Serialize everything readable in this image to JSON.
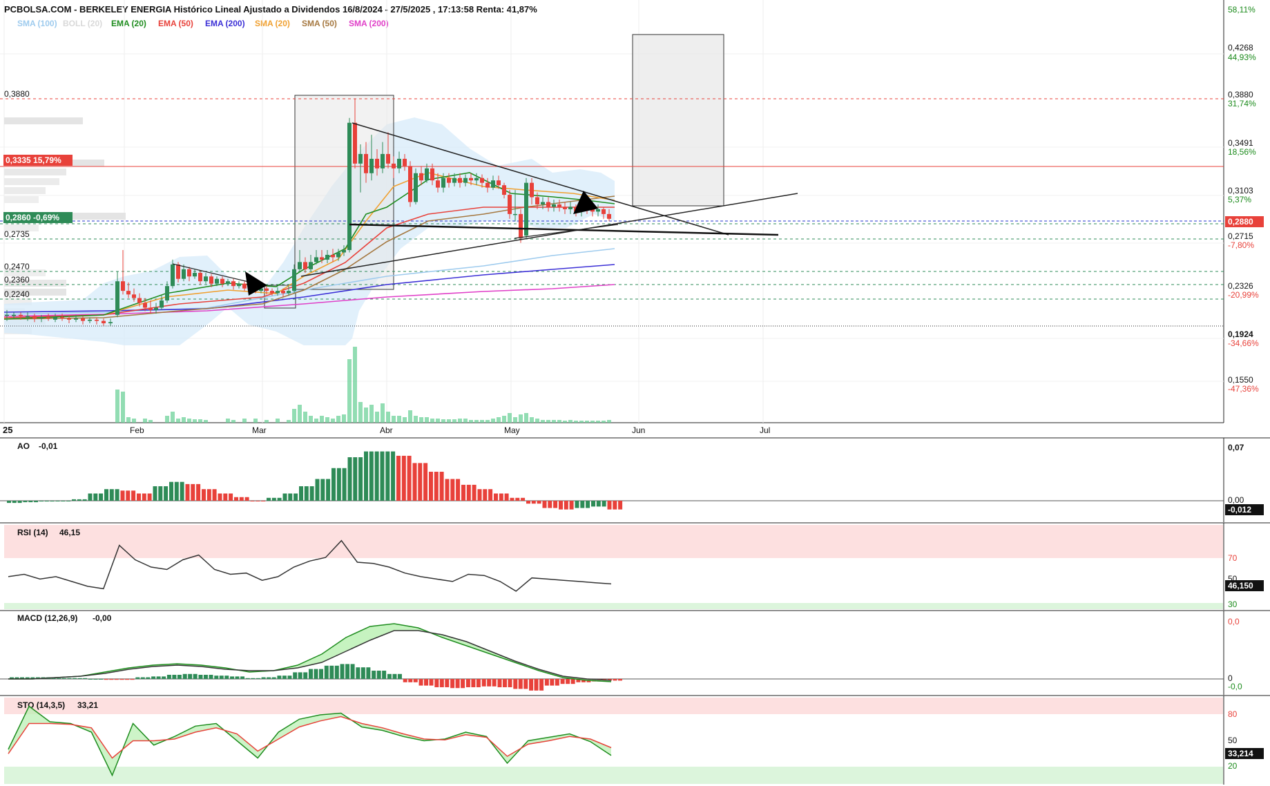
{
  "header": {
    "title": "PCBOLSA.COM - BERKELEY ENERGIA Histórico Lineal Ajustado a Dividendos 16/8/2024 - 27/5/2025 , 17:13:58 Renta: 41,87%",
    "top_right_pct": "58,11%"
  },
  "legend": [
    {
      "label": "SMA (100)",
      "color": "#9ecbee"
    },
    {
      "label": "BOLL (20)",
      "color": "#d9d9d9"
    },
    {
      "label": "EMA (20)",
      "color": "#1e8c1e"
    },
    {
      "label": "EMA (50)",
      "color": "#e8413a"
    },
    {
      "label": "EMA (200)",
      "color": "#3b2fd6"
    },
    {
      "label": "SMA (20)",
      "color": "#f0a030"
    },
    {
      "label": "SMA (50)",
      "color": "#a57840"
    },
    {
      "label": "SMA (200)",
      "color": "#e040c8"
    }
  ],
  "left_labels": {
    "l1": "0,3880",
    "l2": "0,3335 15,79%",
    "l3": "0,2860 -0,69%",
    "l4": "0,2735",
    "l5": "0,2470",
    "l6": "0,2360",
    "l7": "0,2240"
  },
  "right_axis": {
    "t1a": "0,4268",
    "t1b": "44,93%",
    "t2a": "0,3880",
    "t2b": "31,74%",
    "t3a": "0,3491",
    "t3b": "18,56%",
    "t4a": "0,3103",
    "t4b": "5,37%",
    "current": "0,2880",
    "t5a": "0,2715",
    "t5b": "-7,80%",
    "t6a": "0,2326",
    "t6b": "-20,99%",
    "t7a": "0,1924",
    "t7b": "-34,66%",
    "t8a": "0,1550",
    "t8b": "-47,36%"
  },
  "x_axis": {
    "year": "25",
    "months": [
      "Feb",
      "Mar",
      "Abr",
      "May",
      "Jun",
      "Jul"
    ]
  },
  "panels": {
    "ao": {
      "title": "AO",
      "value": "-0,01",
      "top": "0,07",
      "zero": "0,00",
      "current": "-0,012"
    },
    "rsi": {
      "title": "RSI (14)",
      "value": "46,15",
      "upper": "70",
      "mid": "50",
      "lower": "30",
      "current": "46,150"
    },
    "macd": {
      "title": "MACD (12,26,9)",
      "value": "-0,00",
      "top": "0,0",
      "zero": "0",
      "current": "-0,0"
    },
    "sto": {
      "title": "STO (14,3,5)",
      "value": "33,21",
      "upper": "80",
      "mid": "50",
      "lower": "20",
      "current": "33,214"
    }
  },
  "chart_data": [
    {
      "type": "candlestick",
      "title": "PCBOLSA.COM - BERKELEY ENERGIA Histórico Lineal Ajustado a Dividendos 16/8/2024 - 27/5/2025 , 17:13:58 Renta: 41,87%",
      "x_range": [
        "Jan 2025",
        "Jul 2025"
      ],
      "ylim": [
        0.137,
        0.449
      ],
      "series": [
        {
          "name": "Close",
          "color": "#2e8b57",
          "x": [
            "2025-01-02",
            "2025-01-15",
            "2025-01-27",
            "2025-01-29",
            "2025-02-03",
            "2025-02-10",
            "2025-02-12",
            "2025-02-17",
            "2025-02-24",
            "2025-03-03",
            "2025-03-07",
            "2025-03-10",
            "2025-03-12",
            "2025-03-14",
            "2025-03-18",
            "2025-03-24",
            "2025-03-25",
            "2025-03-26",
            "2025-03-28",
            "2025-04-01",
            "2025-04-07",
            "2025-04-10",
            "2025-04-14",
            "2025-04-22",
            "2025-04-25",
            "2025-04-29",
            "2025-05-01",
            "2025-05-05",
            "2025-05-07",
            "2025-05-12",
            "2025-05-16",
            "2025-05-20",
            "2025-05-23",
            "2025-05-27"
          ],
          "values": [
            0.208,
            0.207,
            0.203,
            0.228,
            0.232,
            0.251,
            0.255,
            0.247,
            0.239,
            0.231,
            0.228,
            0.23,
            0.245,
            0.257,
            0.263,
            0.268,
            0.37,
            0.352,
            0.334,
            0.34,
            0.32,
            0.325,
            0.335,
            0.315,
            0.322,
            0.31,
            0.275,
            0.288,
            0.322,
            0.295,
            0.3,
            0.3,
            0.295,
            0.288
          ]
        }
      ],
      "horizontal_levels": [
        0.388,
        0.3335,
        0.286,
        0.2735,
        0.247,
        0.236,
        0.224
      ]
    },
    {
      "type": "bar",
      "title": "AO",
      "ylim": [
        -0.01,
        0.07
      ],
      "series": [
        {
          "name": "AO",
          "values": [
            -0.003,
            -0.002,
            -0.001,
            0.0,
            0.002,
            0.01,
            0.016,
            0.014,
            0.01,
            0.02,
            0.026,
            0.023,
            0.016,
            0.01,
            0.005,
            0.0,
            0.004,
            0.01,
            0.02,
            0.03,
            0.045,
            0.06,
            0.068,
            0.068,
            0.062,
            0.052,
            0.04,
            0.03,
            0.022,
            0.016,
            0.01,
            0.004,
            -0.004,
            -0.01,
            -0.012,
            -0.01,
            -0.008,
            -0.012
          ]
        }
      ]
    },
    {
      "type": "line",
      "title": "RSI (14)",
      "ylim": [
        25,
        95
      ],
      "series": [
        {
          "name": "RSI (14)",
          "values": [
            52,
            54,
            50,
            52,
            48,
            44,
            42,
            78,
            66,
            60,
            58,
            66,
            70,
            58,
            54,
            55,
            49,
            52,
            60,
            65,
            68,
            82,
            64,
            63,
            60,
            55,
            52,
            50,
            48,
            54,
            53,
            48,
            40,
            51,
            50,
            49,
            48,
            47,
            46
          ]
        }
      ]
    },
    {
      "type": "line",
      "title": "MACD (12,26,9)",
      "ylim": [
        -0.012,
        0.044
      ],
      "series": [
        {
          "name": "MACD",
          "values": [
            0.0,
            0.0,
            0.001,
            0.002,
            0.005,
            0.008,
            0.01,
            0.011,
            0.01,
            0.008,
            0.005,
            0.006,
            0.01,
            0.018,
            0.03,
            0.038,
            0.04,
            0.037,
            0.03,
            0.024,
            0.018,
            0.012,
            0.006,
            0.001,
            -0.001,
            -0.002
          ]
        },
        {
          "name": "Signal",
          "values": [
            0.0,
            0.0,
            0.001,
            0.002,
            0.004,
            0.007,
            0.009,
            0.01,
            0.009,
            0.007,
            0.006,
            0.006,
            0.008,
            0.012,
            0.02,
            0.028,
            0.035,
            0.035,
            0.032,
            0.027,
            0.02,
            0.013,
            0.007,
            0.002,
            0.0,
            -0.001
          ]
        }
      ]
    },
    {
      "type": "line",
      "title": "STO (14,3,5)",
      "ylim": [
        0,
        100
      ],
      "series": [
        {
          "name": "%K",
          "values": [
            40,
            90,
            72,
            70,
            60,
            10,
            70,
            45,
            55,
            67,
            70,
            50,
            30,
            60,
            75,
            80,
            82,
            66,
            62,
            55,
            50,
            52,
            60,
            55,
            24,
            50,
            54,
            58,
            49,
            33
          ]
        },
        {
          "name": "%D",
          "values": [
            35,
            70,
            70,
            69,
            65,
            30,
            50,
            50,
            52,
            60,
            65,
            58,
            38,
            52,
            66,
            73,
            78,
            70,
            65,
            58,
            52,
            51,
            57,
            54,
            32,
            46,
            50,
            55,
            52,
            42
          ]
        }
      ]
    }
  ]
}
